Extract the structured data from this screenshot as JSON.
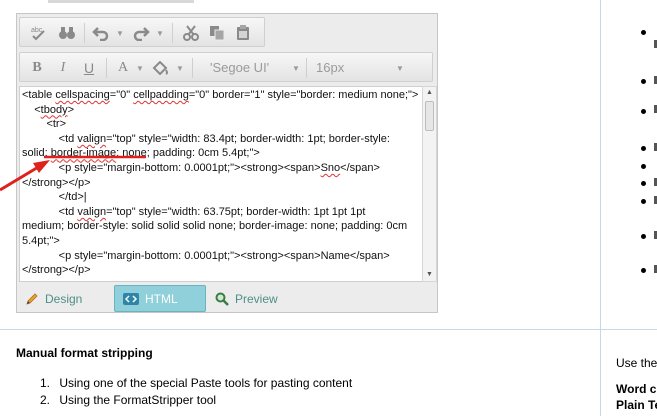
{
  "editor": {
    "font_name": "'Segoe UI'",
    "font_size": "16px",
    "code_lines": [
      [
        "<table ",
        {
          "sq": "cellspacing"
        },
        "=\"0\" ",
        {
          "sq": "cellpadding"
        },
        "=\"0\" border=\"1\" style=\"border: medium none;\">"
      ],
      [
        "    <",
        {
          "sq": "tbody"
        },
        ">"
      ],
      [
        "        <tr>"
      ],
      [
        "            <td ",
        {
          "sq": "valign"
        },
        "=\"top\" style=\"width: 83.4pt; border-width: 1pt; border-style:"
      ],
      [
        "solid; ",
        {
          "sq": "border-image"
        },
        ": none; padding: 0cm 5.4pt;\">"
      ],
      [
        "            <p style=\"margin-bottom: 0.0001pt;\"><strong><span>",
        {
          "sq": "Sno"
        },
        "</span>"
      ],
      [
        "</strong></p>"
      ],
      [
        "            </td>|"
      ],
      [
        "            <td ",
        {
          "sq": "valign"
        },
        "=\"top\" style=\"width: 63.75pt; border-width: 1pt 1pt 1pt"
      ],
      [
        "medium; border-style: solid solid solid none; border-image: none; padding: 0cm"
      ],
      [
        "5.4pt;\">"
      ],
      [
        "            <p style=\"margin-bottom: 0.0001pt;\"><strong><span>Name</span>"
      ],
      [
        "</strong></p>"
      ]
    ],
    "modes": {
      "design": "Design",
      "html": "HTML",
      "preview": "Preview"
    }
  },
  "section": {
    "heading": "Manual format stripping",
    "steps": [
      {
        "num": "1.",
        "text": "Using one of the special Paste tools for pasting content"
      },
      {
        "num": "2.",
        "text": "Using the FormatStripper tool"
      }
    ]
  },
  "right": {
    "use_text": "Use the",
    "word_text_1": "Word c",
    "word_text_2": "Plain Te"
  },
  "colors": {
    "annotation": "#e0201c",
    "active_mode": "#8fd0da",
    "mode_text": "#4e8f87"
  }
}
